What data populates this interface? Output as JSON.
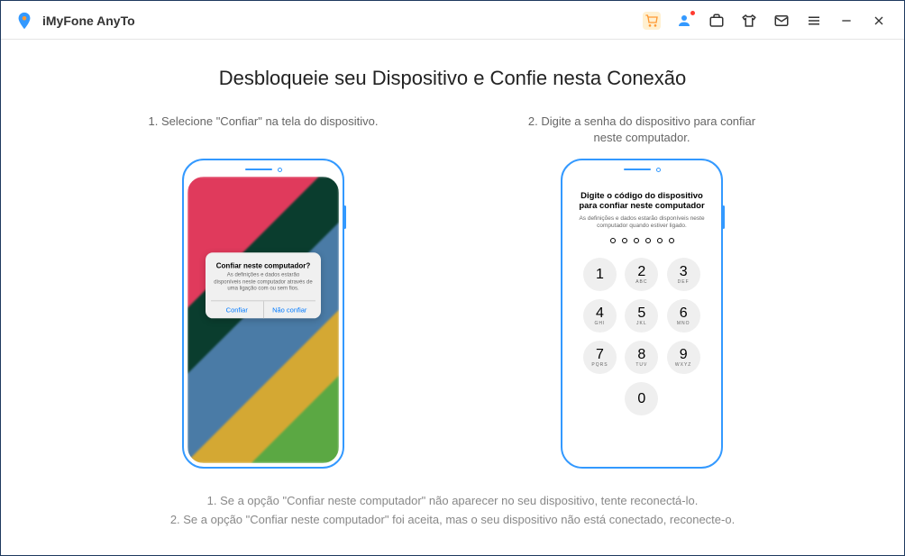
{
  "app": {
    "title": "iMyFone AnyTo"
  },
  "heading": "Desbloqueie seu Dispositivo e Confie nesta Conexão",
  "steps": {
    "one": "1. Selecione \"Confiar\" na tela do dispositivo.",
    "two": "2. Digite a senha do dispositivo para confiar neste computador."
  },
  "dialog": {
    "title": "Confiar neste computador?",
    "body": "As definições e dados estarão disponíveis neste computador através de uma ligação com ou sem fios.",
    "confirm": "Confiar",
    "deny": "Não confiar"
  },
  "passcode": {
    "title": "Digite o código do dispositivo para confiar neste computador",
    "sub": "As definições e dados estarão disponíveis neste computador quando estiver ligado."
  },
  "keypad": [
    {
      "n": "1",
      "l": ""
    },
    {
      "n": "2",
      "l": "ABC"
    },
    {
      "n": "3",
      "l": "DEF"
    },
    {
      "n": "4",
      "l": "GHI"
    },
    {
      "n": "5",
      "l": "JKL"
    },
    {
      "n": "6",
      "l": "MNO"
    },
    {
      "n": "7",
      "l": "PQRS"
    },
    {
      "n": "8",
      "l": "TUV"
    },
    {
      "n": "9",
      "l": "WXYZ"
    },
    {
      "n": "",
      "l": ""
    },
    {
      "n": "0",
      "l": ""
    },
    {
      "n": "",
      "l": ""
    }
  ],
  "notes": {
    "a": "1. Se a opção \"Confiar neste computador\" não aparecer no seu dispositivo, tente reconectá-lo.",
    "b": "2. Se a opção \"Confiar neste computador\" foi aceita, mas o seu dispositivo não está conectado, reconecte-o."
  }
}
